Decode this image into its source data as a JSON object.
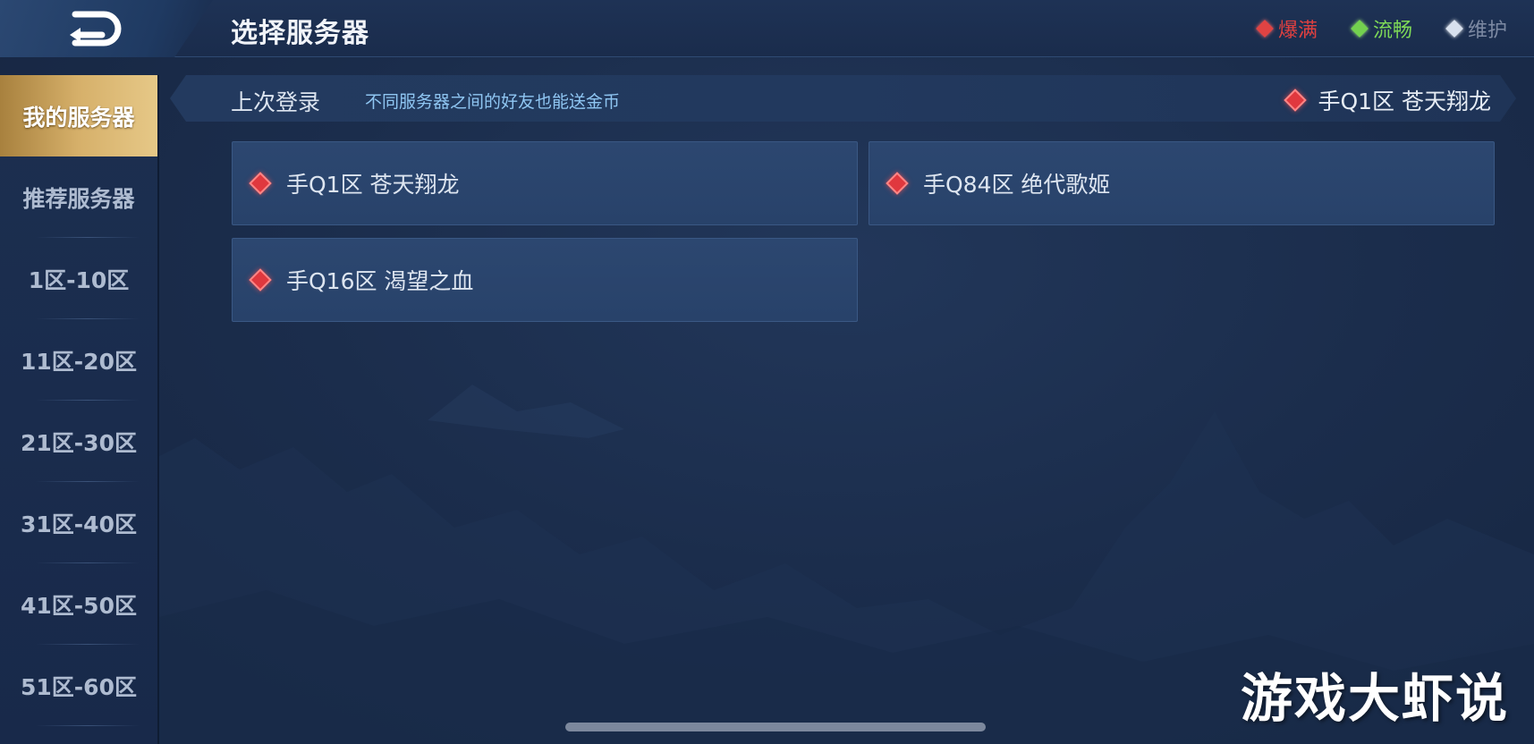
{
  "header": {
    "title": "选择服务器",
    "back_icon": "back-arrow-icon",
    "legend": [
      {
        "label": "爆满",
        "color": "#e04343"
      },
      {
        "label": "流畅",
        "color": "#73d14f"
      },
      {
        "label": "维护",
        "color": "#d9e1ee"
      }
    ]
  },
  "sidebar": {
    "items": [
      {
        "label": "我的服务器",
        "active": true
      },
      {
        "label": "推荐服务器"
      },
      {
        "label": "1区-10区"
      },
      {
        "label": "11区-20区"
      },
      {
        "label": "21区-30区"
      },
      {
        "label": "31区-40区"
      },
      {
        "label": "41区-50区"
      },
      {
        "label": "51区-60区"
      }
    ]
  },
  "last_login": {
    "label": "上次登录",
    "tip": "不同服务器之间的好友也能送金币",
    "server": "手Q1区 苍天翔龙",
    "status_color": "#e0383e"
  },
  "servers": [
    {
      "name": "手Q1区 苍天翔龙",
      "status_color": "#e0383e"
    },
    {
      "name": "手Q84区 绝代歌姬",
      "status_color": "#e0383e"
    },
    {
      "name": "手Q16区 渴望之血",
      "status_color": "#e0383e"
    }
  ],
  "watermark": "游戏大虾说"
}
